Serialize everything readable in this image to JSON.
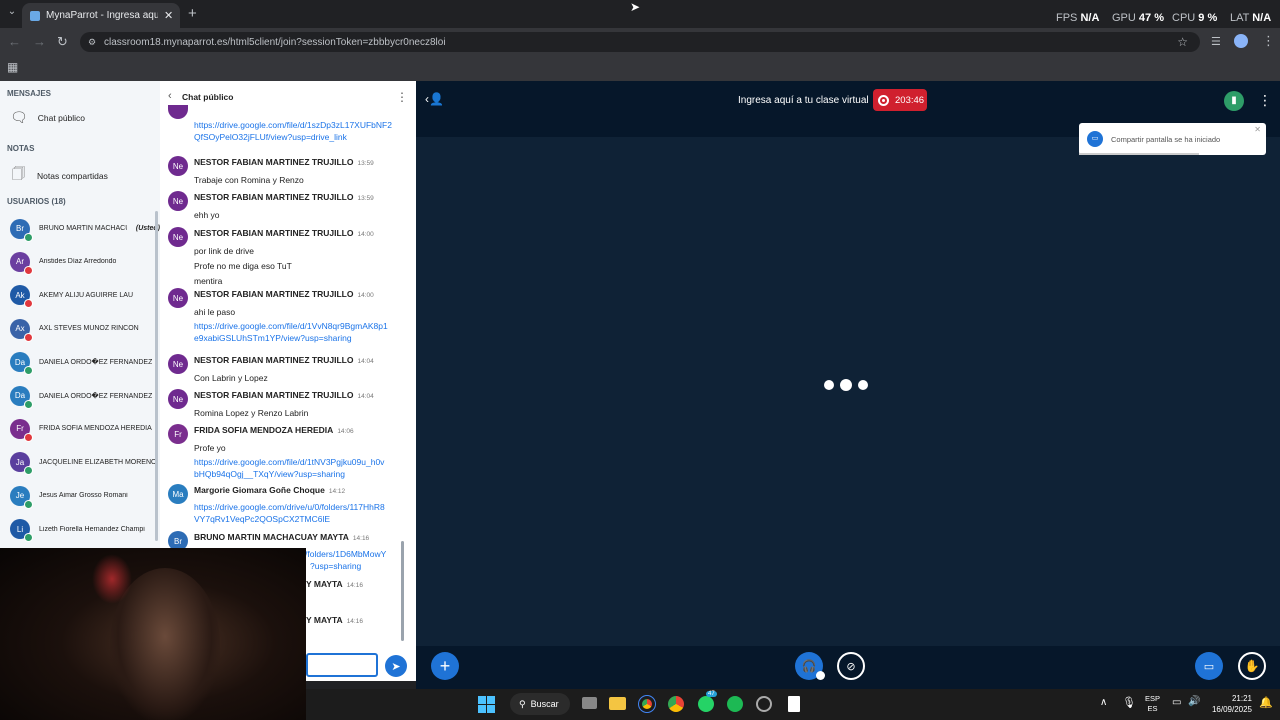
{
  "browser": {
    "tab_title": "MynaParrot - Ingresa aquí a tu",
    "url": "classroom18.mynaparrot.es/html5client/join?sessionToken=zbbbycr0necz8loi",
    "perf": {
      "fps_label": "FPS",
      "fps": "N/A",
      "gpu_label": "GPU",
      "gpu": "47 %",
      "cpu_label": "CPU",
      "cpu": "9 %",
      "lat_label": "LAT",
      "lat": "N/A"
    }
  },
  "sidebar": {
    "messages_header": "MENSAJES",
    "public_chat": "Chat público",
    "notes_header": "NOTAS",
    "shared_notes": "Notas compartidas",
    "users_header": "USUARIOS (18)",
    "you_label": "(Usted)",
    "users": [
      {
        "initials": "Br",
        "name": "BRUNO MARTIN MACHACU...",
        "color": "#2d6cb5",
        "status": "#2e9d68"
      },
      {
        "initials": "Ar",
        "name": "Aristides Díaz Arredondo",
        "color": "#6b3fa0",
        "status": "#e0383e"
      },
      {
        "initials": "Ak",
        "name": "AKEMY ALIJU AGUIRRE LAU",
        "color": "#1f5aa6",
        "status": "#e0383e"
      },
      {
        "initials": "Ax",
        "name": "AXL STEVES MUÑOZ RINCON",
        "color": "#3a63a8",
        "status": "#e0383e"
      },
      {
        "initials": "Da",
        "name": "DANIELA ORDO�EZ FERNANDEZ",
        "color": "#2a7dbf",
        "status": "#2e9d68"
      },
      {
        "initials": "Da",
        "name": "DANIELA ORDO�EZ FERNANDEZ",
        "color": "#2a7dbf",
        "status": "#2e9d68"
      },
      {
        "initials": "Fr",
        "name": "FRIDA SOFIA MENDOZA HEREDIA",
        "color": "#7a2e8e",
        "status": "#e0383e"
      },
      {
        "initials": "Ja",
        "name": "JACQUELINE ELIZABETH MORENO...",
        "color": "#5a3f9e",
        "status": "#2e9d68"
      },
      {
        "initials": "Je",
        "name": "Jesus Aimar Grosso Romani",
        "color": "#2a7dbf",
        "status": "#2e9d68"
      },
      {
        "initials": "Li",
        "name": "Lizeth Fiorella Hernandez Champi",
        "color": "#1f5aa6",
        "status": "#2e9d68"
      }
    ]
  },
  "chat": {
    "title": "Chat público",
    "top_link": [
      "https://drive.google.com/file/d/1szDp3zL17XUFbNF2",
      "QfSOyPelO32jFLUf/view?usp=drive_link"
    ],
    "messages": [
      {
        "initials": "Ne",
        "color": "#6f2a8f",
        "name": "NESTOR FABIAN MARTINEZ TRUJILLO",
        "time": "13:59",
        "lines": [
          "Trabaje con Romina y Renzo"
        ],
        "links": []
      },
      {
        "initials": "Ne",
        "color": "#6f2a8f",
        "name": "NESTOR FABIAN MARTINEZ TRUJILLO",
        "time": "13:59",
        "lines": [
          "ehh yo"
        ],
        "links": []
      },
      {
        "initials": "Ne",
        "color": "#6f2a8f",
        "name": "NESTOR FABIAN MARTINEZ TRUJILLO",
        "time": "14:00",
        "lines": [
          "por link de drive",
          "Profe no me diga eso TuT",
          "mentira"
        ],
        "links": []
      },
      {
        "initials": "Ne",
        "color": "#6f2a8f",
        "name": "NESTOR FABIAN MARTINEZ TRUJILLO",
        "time": "14:00",
        "lines": [
          "ahi le paso"
        ],
        "links": [
          "https://drive.google.com/file/d/1VvN8qr9BgmAK8p1",
          "e9xabiGSLUhSTm1YP/view?usp=sharing"
        ]
      },
      {
        "initials": "Ne",
        "color": "#6f2a8f",
        "name": "NESTOR FABIAN MARTINEZ TRUJILLO",
        "time": "14:04",
        "lines": [
          "Con Labrin y Lopez"
        ],
        "links": []
      },
      {
        "initials": "Ne",
        "color": "#6f2a8f",
        "name": "NESTOR FABIAN MARTINEZ TRUJILLO",
        "time": "14:04",
        "lines": [
          "Romina Lopez y Renzo Labrin"
        ],
        "links": []
      },
      {
        "initials": "Fr",
        "color": "#7a2e8e",
        "name": "FRIDA SOFIA MENDOZA HEREDIA",
        "time": "14:06",
        "lines": [
          "Profe yo"
        ],
        "links": [
          "https://drive.google.com/file/d/1tNV3Pgjku09u_h0v",
          "bHQb94qOgj__TXqY/view?usp=sharing"
        ]
      },
      {
        "initials": "Ma",
        "color": "#2a7dbf",
        "name": "Margorie Giomara Goñe Choque",
        "time": "14:12",
        "lines": [],
        "links": [
          "https://drive.google.com/drive/u/0/folders/117HhR8",
          "VY7qRv1VeqPc2QOSpCX2TMC6lE"
        ]
      },
      {
        "initials": "Br",
        "color": "#2d6cb5",
        "name": "BRUNO MARTIN MACHACUAY MAYTA",
        "time": "14:16",
        "lines": [],
        "links": [
          "https://drive.google.com/drive/folders/1D6MbMowY",
          "?usp=sharing"
        ]
      }
    ],
    "partial_names": [
      {
        "name": "Y MAYTA",
        "time": "14:16"
      },
      {
        "name": "Y MAYTA",
        "time": "14:16"
      }
    ]
  },
  "main": {
    "room_title": "Ingresa aquí a tu clase virtual",
    "record_time": "203:46",
    "toast": "Compartir pantalla se ha iniciado",
    "colors": {
      "record": "#d0202e",
      "action": "#1f73d6",
      "connection": "#2e9d68"
    }
  },
  "taskbar": {
    "search": "Buscar",
    "lang": "ESP",
    "region": "ES",
    "time": "21:21",
    "date": "16/09/2025",
    "whatsapp_badge": "47"
  }
}
